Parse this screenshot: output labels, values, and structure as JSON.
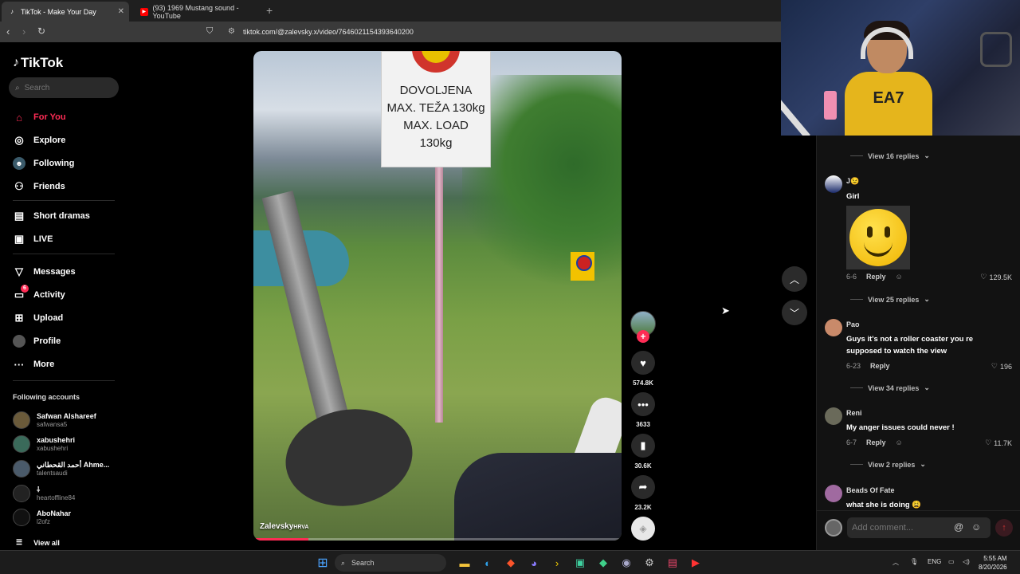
{
  "browser": {
    "tabs": [
      {
        "title": "TikTok - Make Your Day",
        "icon": "tiktok-icon"
      },
      {
        "title": "(93) 1969 Mustang sound - YouTube",
        "icon": "youtube-icon"
      }
    ],
    "url": "tiktok.com/@zalevsky.x/video/7646021154393640200"
  },
  "sidebar": {
    "logo": "TikTok",
    "search_placeholder": "Search",
    "nav": [
      {
        "label": "For You",
        "icon": "home-icon"
      },
      {
        "label": "Explore",
        "icon": "compass-icon"
      },
      {
        "label": "Following",
        "icon": "following-icon"
      },
      {
        "label": "Friends",
        "icon": "friends-icon"
      },
      {
        "label": "Short dramas",
        "icon": "film-icon"
      },
      {
        "label": "LIVE",
        "icon": "live-icon"
      },
      {
        "label": "Messages",
        "icon": "send-icon"
      },
      {
        "label": "Activity",
        "icon": "inbox-icon",
        "badge": "6"
      },
      {
        "label": "Upload",
        "icon": "upload-icon"
      },
      {
        "label": "Profile",
        "icon": "profile-icon"
      },
      {
        "label": "More",
        "icon": "more-icon"
      }
    ],
    "following_title": "Following accounts",
    "accounts": [
      {
        "name": "Safwan Alshareef",
        "handle": "safwansa5"
      },
      {
        "name": "xabushehri",
        "handle": "xabushehri"
      },
      {
        "name": "أحمد القحطاني Ahme...",
        "handle": "talentsaudi"
      },
      {
        "name": "⸸",
        "handle": "heartoffline84"
      },
      {
        "name": "AboNahar",
        "handle": "l2ofz"
      }
    ],
    "view_all": "View all"
  },
  "video": {
    "sign_lines": [
      "DOVOLJENA",
      "MAX. TEŽA 130kg",
      "MAX. LOAD",
      "130kg"
    ],
    "author": "Zalevsky",
    "author_suffix": "HRVA",
    "progress": 0.15
  },
  "actions": {
    "likes": "574.8K",
    "comments": "3633",
    "saves": "30.6K",
    "shares": "23.2K"
  },
  "comments": {
    "items": [
      {
        "type": "replies",
        "label": "View 16 replies"
      },
      {
        "name": "J😉",
        "text": "Girl",
        "date": "6-6",
        "reply": "Reply",
        "likes": "129.5K",
        "has_image": true
      },
      {
        "type": "replies",
        "label": "View 25 replies"
      },
      {
        "name": "Pao",
        "text": "Guys it's not a roller coaster you re supposed to watch the view",
        "date": "6-23",
        "reply": "Reply",
        "likes": "196"
      },
      {
        "type": "replies",
        "label": "View 34 replies"
      },
      {
        "name": "Reni",
        "text": "My anger issues could never !",
        "date": "6-7",
        "reply": "Reply",
        "likes": "11.7K"
      },
      {
        "type": "replies",
        "label": "View 2 replies"
      },
      {
        "name": "Beads Of Fate",
        "text": "what she is doing 😩"
      }
    ],
    "input_placeholder": "Add comment..."
  },
  "webcam": {
    "shirt_text": "EA7"
  },
  "taskbar": {
    "search": "Search",
    "lang": "ENG",
    "time": "5:55 AM",
    "date": "8/20/2026"
  }
}
